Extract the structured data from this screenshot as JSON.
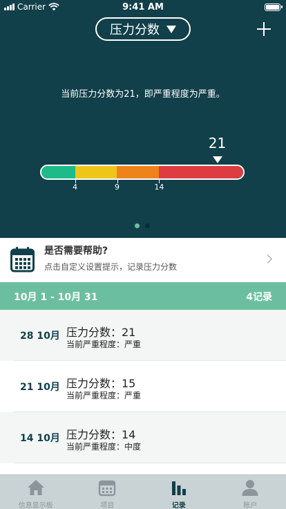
{
  "status_bar": {
    "carrier": "Carrier",
    "time": "9:41 AM"
  },
  "header": {
    "score_button_label": "压力分数"
  },
  "hero": {
    "message": "当前压力分数为21，即严重程度为严重。",
    "score": "21",
    "score_value": 21,
    "scale": {
      "min": 0,
      "max": 24,
      "segments": [
        {
          "from": 0,
          "to": 4,
          "color": "#1dbb8a"
        },
        {
          "from": 4,
          "to": 9,
          "color": "#eec619"
        },
        {
          "from": 9,
          "to": 14,
          "color": "#ee8319"
        },
        {
          "from": 14,
          "to": 24,
          "color": "#dd3d40"
        }
      ],
      "ticks": [
        {
          "value": 4,
          "label": "4"
        },
        {
          "value": 9,
          "label": "9"
        },
        {
          "value": 14,
          "label": "14"
        }
      ]
    },
    "pager": {
      "count": 2,
      "active": 0
    },
    "colors": {
      "background": "#113f4a",
      "dot_active": "#6bbfa0",
      "dot_inactive": "#0b2c34"
    }
  },
  "help": {
    "icon": "calendar-icon",
    "title": "是否需要帮助?",
    "subtitle": "点击自定义设置提示，记录压力分数"
  },
  "period": {
    "range": "10月 1 - 10月 31",
    "count": "4记录",
    "color": "#6bbfa0"
  },
  "records": [
    {
      "date": "28 10月",
      "score": "压力分数：21",
      "severity": "当前严重程度：严重",
      "bg": "#f3f6f5"
    },
    {
      "date": "21 10月",
      "score": "压力分数：15",
      "severity": "当前严重程度：严重",
      "bg": "#ffffff"
    },
    {
      "date": "14 10月",
      "score": "压力分数：14",
      "severity": "当前严重程度：中度",
      "bg": "#f3f6f5"
    },
    {
      "date": "",
      "score": "",
      "severity": "",
      "bg": "#ffffff"
    }
  ],
  "tabbar": {
    "tabs": [
      {
        "label": "信息显示板",
        "icon": "home-icon",
        "active": false
      },
      {
        "label": "项目",
        "icon": "calendar-icon",
        "active": false
      },
      {
        "label": "记录",
        "icon": "bar-chart-icon",
        "active": true
      },
      {
        "label": "账户",
        "icon": "person-icon",
        "active": false
      }
    ]
  }
}
